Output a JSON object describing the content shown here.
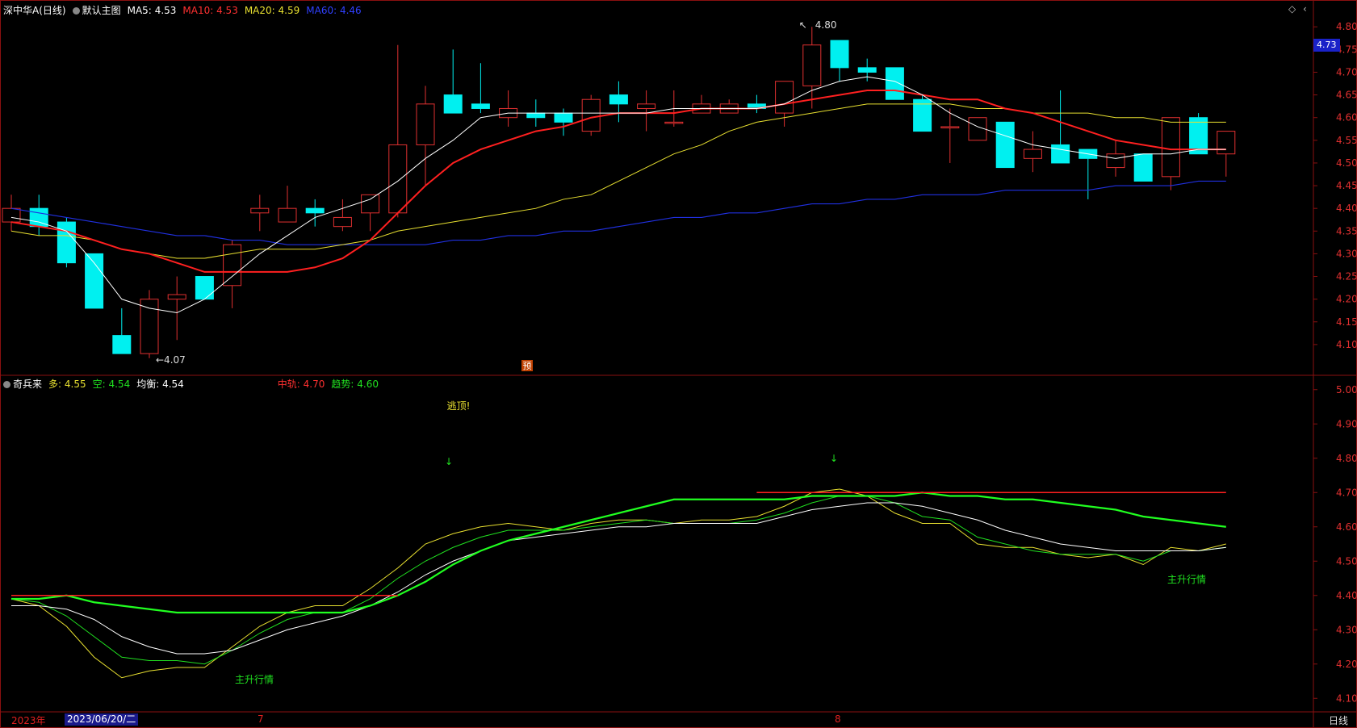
{
  "main_header": {
    "stock": "深中华A",
    "period_tag": "(日线)",
    "template": "默认主图",
    "ma5_label": "MA5:",
    "ma5_value": "4.53",
    "ma10_label": "MA10:",
    "ma10_value": "4.53",
    "ma20_label": "MA20:",
    "ma20_value": "4.59",
    "ma60_label": "MA60:",
    "ma60_value": "4.46"
  },
  "sub_header": {
    "indicator": "奇兵来",
    "duo_label": "多:",
    "duo_value": "4.55",
    "kong_label": "空:",
    "kong_value": "4.54",
    "jun_label": "均衡:",
    "jun_value": "4.54",
    "zhonggui_label": "中轨:",
    "zhonggui_value": "4.70",
    "qushi_label": "趋势:",
    "qushi_value": "4.60"
  },
  "current_price_tag": "4.73",
  "annotations": {
    "high_label": "4.80",
    "low_label": "←4.07",
    "yu_marker": "预",
    "escape_top": "逃顶!",
    "main_rise_1": "主升行情",
    "main_rise_2": "主升行情"
  },
  "footer": {
    "year": "2023年",
    "date": "2023/06/20/二",
    "month_7": "7",
    "month_8": "8",
    "period": "日线"
  },
  "colors": {
    "up": "#e03030",
    "down": "#00f0f0",
    "ma5": "#ffffff",
    "ma10": "#ff2020",
    "ma20": "#e8e030",
    "ma60": "#2030e0",
    "grid": "#8a1010",
    "green": "#20e020"
  },
  "chart_data": [
    {
      "type": "candlestick",
      "title": "深中华A (日线)",
      "ylim": [
        4.05,
        4.82
      ],
      "y_ticks": [
        4.1,
        4.15,
        4.2,
        4.25,
        4.3,
        4.35,
        4.4,
        4.45,
        4.5,
        4.55,
        4.6,
        4.65,
        4.7,
        4.75,
        4.8
      ],
      "candles": [
        [
          4.37,
          4.4,
          4.43,
          4.35
        ],
        [
          4.4,
          4.36,
          4.43,
          4.34
        ],
        [
          4.37,
          4.28,
          4.38,
          4.27
        ],
        [
          4.3,
          4.18,
          4.3,
          4.18
        ],
        [
          4.12,
          4.08,
          4.18,
          4.08
        ],
        [
          4.08,
          4.2,
          4.22,
          4.07
        ],
        [
          4.2,
          4.21,
          4.25,
          4.11
        ],
        [
          4.25,
          4.2,
          4.25,
          4.2
        ],
        [
          4.23,
          4.32,
          4.33,
          4.18
        ],
        [
          4.39,
          4.4,
          4.43,
          4.35
        ],
        [
          4.37,
          4.4,
          4.45,
          4.37
        ],
        [
          4.4,
          4.39,
          4.42,
          4.36
        ],
        [
          4.36,
          4.38,
          4.42,
          4.35
        ],
        [
          4.39,
          4.43,
          4.43,
          4.35
        ],
        [
          4.39,
          4.54,
          4.76,
          4.38
        ],
        [
          4.54,
          4.63,
          4.67,
          4.45
        ],
        [
          4.65,
          4.61,
          4.75,
          4.61
        ],
        [
          4.63,
          4.62,
          4.72,
          4.61
        ],
        [
          4.6,
          4.62,
          4.66,
          4.58
        ],
        [
          4.61,
          4.6,
          4.64,
          4.58
        ],
        [
          4.61,
          4.59,
          4.62,
          4.56
        ],
        [
          4.57,
          4.64,
          4.65,
          4.56
        ],
        [
          4.65,
          4.63,
          4.68,
          4.59
        ],
        [
          4.62,
          4.63,
          4.66,
          4.57
        ],
        [
          4.59,
          4.59,
          4.66,
          4.58
        ],
        [
          4.61,
          4.63,
          4.65,
          4.61
        ],
        [
          4.61,
          4.63,
          4.64,
          4.61
        ],
        [
          4.63,
          4.62,
          4.65,
          4.61
        ],
        [
          4.61,
          4.68,
          4.68,
          4.58
        ],
        [
          4.67,
          4.76,
          4.8,
          4.62
        ],
        [
          4.77,
          4.71,
          4.77,
          4.68
        ],
        [
          4.71,
          4.7,
          4.73,
          4.68
        ],
        [
          4.71,
          4.64,
          4.71,
          4.64
        ],
        [
          4.64,
          4.57,
          4.65,
          4.57
        ],
        [
          4.58,
          4.58,
          4.62,
          4.5
        ],
        [
          4.55,
          4.6,
          4.6,
          4.55
        ],
        [
          4.59,
          4.49,
          4.59,
          4.49
        ],
        [
          4.51,
          4.53,
          4.57,
          4.48
        ],
        [
          4.54,
          4.5,
          4.66,
          4.5
        ],
        [
          4.53,
          4.51,
          4.53,
          4.42
        ],
        [
          4.49,
          4.52,
          4.55,
          4.47
        ],
        [
          4.52,
          4.46,
          4.52,
          4.46
        ],
        [
          4.47,
          4.6,
          4.6,
          4.44
        ],
        [
          4.6,
          4.52,
          4.61,
          4.52
        ],
        [
          4.52,
          4.57,
          4.57,
          4.47
        ]
      ],
      "ma5": [
        4.38,
        4.37,
        4.35,
        4.28,
        4.2,
        4.18,
        4.17,
        4.2,
        4.25,
        4.3,
        4.34,
        4.38,
        4.4,
        4.42,
        4.46,
        4.51,
        4.55,
        4.6,
        4.61,
        4.61,
        4.61,
        4.61,
        4.61,
        4.61,
        4.62,
        4.62,
        4.62,
        4.62,
        4.63,
        4.66,
        4.68,
        4.69,
        4.68,
        4.65,
        4.61,
        4.58,
        4.56,
        4.54,
        4.53,
        4.52,
        4.51,
        4.52,
        4.52,
        4.53,
        4.53
      ],
      "ma10": [
        4.37,
        4.36,
        4.35,
        4.33,
        4.31,
        4.3,
        4.28,
        4.26,
        4.26,
        4.26,
        4.26,
        4.27,
        4.29,
        4.33,
        4.39,
        4.45,
        4.5,
        4.53,
        4.55,
        4.57,
        4.58,
        4.6,
        4.61,
        4.61,
        4.61,
        4.62,
        4.62,
        4.62,
        4.63,
        4.64,
        4.65,
        4.66,
        4.66,
        4.65,
        4.64,
        4.64,
        4.62,
        4.61,
        4.59,
        4.57,
        4.55,
        4.54,
        4.53,
        4.53,
        4.53
      ],
      "ma20": [
        4.35,
        4.34,
        4.34,
        4.33,
        4.31,
        4.3,
        4.29,
        4.29,
        4.3,
        4.31,
        4.31,
        4.31,
        4.32,
        4.33,
        4.35,
        4.36,
        4.37,
        4.38,
        4.39,
        4.4,
        4.42,
        4.43,
        4.46,
        4.49,
        4.52,
        4.54,
        4.57,
        4.59,
        4.6,
        4.61,
        4.62,
        4.63,
        4.63,
        4.63,
        4.63,
        4.62,
        4.62,
        4.61,
        4.61,
        4.61,
        4.6,
        4.6,
        4.59,
        4.59,
        4.59
      ],
      "ma60": [
        4.4,
        4.39,
        4.38,
        4.37,
        4.36,
        4.35,
        4.34,
        4.34,
        4.33,
        4.33,
        4.32,
        4.32,
        4.32,
        4.32,
        4.32,
        4.32,
        4.33,
        4.33,
        4.34,
        4.34,
        4.35,
        4.35,
        4.36,
        4.37,
        4.38,
        4.38,
        4.39,
        4.39,
        4.4,
        4.41,
        4.41,
        4.42,
        4.42,
        4.43,
        4.43,
        4.43,
        4.44,
        4.44,
        4.44,
        4.44,
        4.45,
        4.45,
        4.45,
        4.46,
        4.46
      ]
    },
    {
      "type": "line",
      "title": "奇兵来",
      "ylim": [
        4.07,
        5.03
      ],
      "y_ticks": [
        4.1,
        4.2,
        4.3,
        4.4,
        4.5,
        4.6,
        4.7,
        4.8,
        4.9,
        5.0
      ],
      "series": [
        {
          "name": "多",
          "color": "#e8e030",
          "values": [
            4.39,
            4.37,
            4.31,
            4.22,
            4.16,
            4.18,
            4.19,
            4.19,
            4.25,
            4.31,
            4.35,
            4.37,
            4.37,
            4.42,
            4.48,
            4.55,
            4.58,
            4.6,
            4.61,
            4.6,
            4.59,
            4.61,
            4.62,
            4.62,
            4.61,
            4.62,
            4.62,
            4.63,
            4.66,
            4.7,
            4.71,
            4.69,
            4.64,
            4.61,
            4.61,
            4.55,
            4.54,
            4.54,
            4.52,
            4.51,
            4.52,
            4.49,
            4.54,
            4.53,
            4.55
          ]
        },
        {
          "name": "空",
          "color": "#20e020",
          "values": [
            4.39,
            4.38,
            4.34,
            4.28,
            4.22,
            4.21,
            4.21,
            4.2,
            4.24,
            4.29,
            4.33,
            4.35,
            4.35,
            4.39,
            4.45,
            4.5,
            4.54,
            4.57,
            4.59,
            4.59,
            4.59,
            4.6,
            4.61,
            4.62,
            4.61,
            4.61,
            4.61,
            4.62,
            4.64,
            4.67,
            4.69,
            4.69,
            4.67,
            4.63,
            4.62,
            4.57,
            4.55,
            4.53,
            4.52,
            4.52,
            4.52,
            4.5,
            4.53,
            4.53,
            4.54
          ]
        },
        {
          "name": "均衡",
          "color": "#ffffff",
          "values": [
            4.37,
            4.37,
            4.36,
            4.33,
            4.28,
            4.25,
            4.23,
            4.23,
            4.24,
            4.27,
            4.3,
            4.32,
            4.34,
            4.37,
            4.41,
            4.46,
            4.5,
            4.53,
            4.56,
            4.57,
            4.58,
            4.59,
            4.6,
            4.6,
            4.61,
            4.61,
            4.61,
            4.61,
            4.63,
            4.65,
            4.66,
            4.67,
            4.67,
            4.66,
            4.64,
            4.62,
            4.59,
            4.57,
            4.55,
            4.54,
            4.53,
            4.53,
            4.53,
            4.53,
            4.54
          ]
        },
        {
          "name": "趋势",
          "color": "#20ff20",
          "values": [
            4.39,
            4.39,
            4.4,
            4.38,
            4.37,
            4.36,
            4.35,
            4.35,
            4.35,
            4.35,
            4.35,
            4.35,
            4.35,
            4.37,
            4.4,
            4.44,
            4.49,
            4.53,
            4.56,
            4.58,
            4.6,
            4.62,
            4.64,
            4.66,
            4.68,
            4.68,
            4.68,
            4.68,
            4.68,
            4.69,
            4.69,
            4.69,
            4.69,
            4.7,
            4.69,
            4.69,
            4.68,
            4.68,
            4.67,
            4.66,
            4.65,
            4.63,
            4.62,
            4.61,
            4.6
          ]
        },
        {
          "name": "中轨",
          "color": "#ff2020",
          "segments": [
            [
              0,
              14,
              4.4
            ],
            [
              27,
              44,
              4.7
            ]
          ]
        }
      ]
    }
  ]
}
